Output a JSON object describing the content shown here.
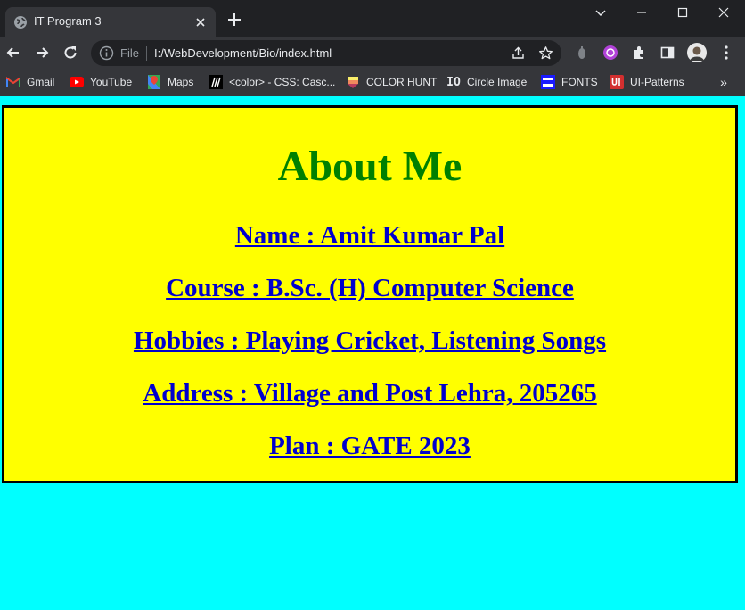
{
  "browser": {
    "tab_title": "IT Program 3",
    "address_scheme_label": "File",
    "url": "I:/WebDevelopment/Bio/index.html"
  },
  "bookmarks": [
    {
      "label": "Gmail",
      "icon": "gmail-icon"
    },
    {
      "label": "YouTube",
      "icon": "youtube-icon"
    },
    {
      "label": "Maps",
      "icon": "maps-icon"
    },
    {
      "label": "<color> - CSS: Casc...",
      "icon": "mdn-icon"
    },
    {
      "label": "COLOR HUNT",
      "icon": "colorhunt-icon"
    },
    {
      "label": "Circle Image",
      "icon": "circle-image-icon"
    },
    {
      "label": "FONTS",
      "icon": "fonts-icon"
    },
    {
      "label": "UI-Patterns",
      "icon": "ui-patterns-icon"
    }
  ],
  "colors": {
    "page_background": "#00ffff",
    "box_background": "#ffff00",
    "heading": "#008000",
    "link": "#0000cd"
  },
  "page": {
    "heading": "About Me",
    "lines": [
      "Name : Amit Kumar Pal",
      "Course : B.Sc. (H) Computer Science",
      "Hobbies : Playing Cricket, Listening Songs",
      "Address : Village and Post Lehra, 205265",
      "Plan : GATE 2023"
    ]
  }
}
